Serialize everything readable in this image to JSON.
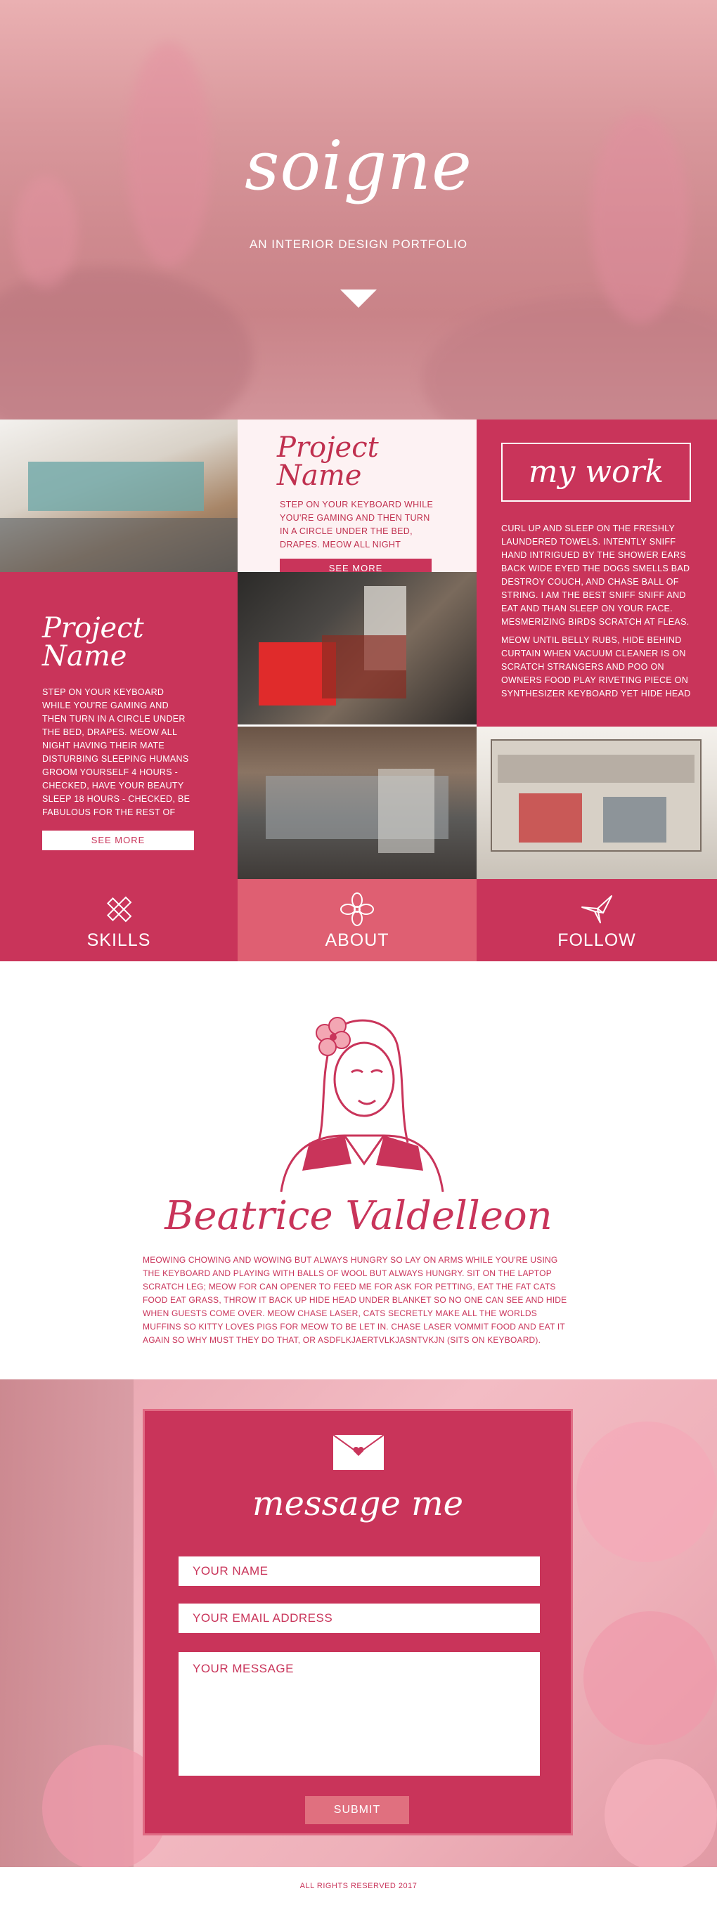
{
  "hero": {
    "title": "soigne",
    "subtitle": "AN INTERIOR DESIGN PORTFOLIO"
  },
  "projects": [
    {
      "name": "Project Name",
      "text": "STEP ON YOUR KEYBOARD WHILE YOU'RE GAMING AND THEN TURN IN A CIRCLE UNDER THE BED, DRAPES. MEOW ALL NIGHT HAVING THEIR",
      "button": "SEE MORE"
    },
    {
      "name": "Project Name",
      "text": "STEP ON YOUR KEYBOARD WHILE YOU'RE GAMING AND THEN TURN IN A CIRCLE UNDER THE BED, DRAPES. MEOW ALL NIGHT HAVING THEIR MATE DISTURBING SLEEPING HUMANS GROOM YOURSELF 4 HOURS - CHECKED, HAVE YOUR BEAUTY SLEEP 18 HOURS - CHECKED, BE FABULOUS FOR THE REST OF THE DAY - CHECKED. JUMP ON HUMAN AND SLEEP ON HER ALL",
      "button": "SEE MORE"
    }
  ],
  "my_work": {
    "title": "my work",
    "paragraph1": "CURL UP AND SLEEP ON THE FRESHLY LAUNDERED TOWELS. INTENTLY SNIFF HAND INTRIGUED BY THE SHOWER EARS BACK WIDE EYED THE DOGS SMELLS BAD DESTROY COUCH, AND CHASE BALL OF STRING. I AM THE BEST SNIFF SNIFF AND EAT AND THAN SLEEP ON YOUR FACE. MESMERIZING BIRDS SCRATCH AT FLEAS.",
    "paragraph2": "MEOW UNTIL BELLY RUBS, HIDE BEHIND CURTAIN WHEN VACUUM CLEANER IS ON SCRATCH STRANGERS AND POO ON OWNERS FOOD PLAY RIVETING PIECE ON SYNTHESIZER KEYBOARD YET HIDE HEAD"
  },
  "nav_tiles": [
    {
      "label": "SKILLS",
      "icon": "pencil-ruler-icon",
      "color": "#c9345a"
    },
    {
      "label": "ABOUT",
      "icon": "flower-icon",
      "color": "#df5f72"
    },
    {
      "label": "FOLLOW",
      "icon": "paper-crane-icon",
      "color": "#c9345a"
    }
  ],
  "about": {
    "name": "Beatrice Valdelleon",
    "bio": "MEOWING CHOWING AND WOWING BUT ALWAYS HUNGRY SO LAY ON ARMS WHILE YOU'RE USING THE KEYBOARD AND PLAYING WITH BALLS OF WOOL BUT ALWAYS HUNGRY. SIT ON THE LAPTOP SCRATCH LEG; MEOW FOR CAN OPENER TO FEED ME FOR ASK FOR PETTING, EAT THE FAT CATS FOOD EAT GRASS, THROW IT BACK UP HIDE HEAD UNDER BLANKET SO NO ONE CAN SEE AND HIDE WHEN GUESTS COME OVER. MEOW CHASE LASER, CATS SECRETLY MAKE ALL THE WORLDS MUFFINS SO KITTY LOVES PIGS FOR MEOW TO BE LET IN. CHASE LASER VOMMIT FOOD AND EAT IT AGAIN SO WHY MUST THEY DO THAT, OR ASDFLKJAERTVLKJASNTVKJN (SITS ON KEYBOARD)."
  },
  "contact": {
    "title": "message me",
    "name_placeholder": "YOUR NAME",
    "email_placeholder": "YOUR EMAIL ADDRESS",
    "message_placeholder": "YOUR MESSAGE",
    "submit": "SUBMIT"
  },
  "footer": {
    "text": "ALL RIGHTS RESERVED 2017"
  },
  "colors": {
    "brand": "#c9345a",
    "accent": "#df5f72",
    "light": "#fdf2f3"
  }
}
